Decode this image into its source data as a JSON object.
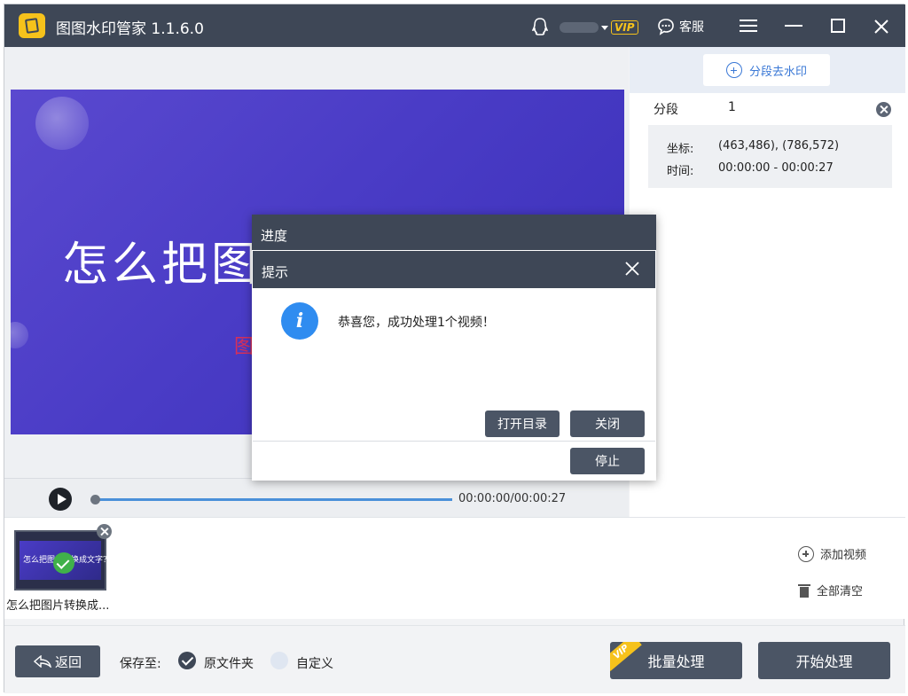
{
  "app": {
    "title": "图图水印管家",
    "version": "1.1.6.0"
  },
  "titlebar": {
    "vip_badge": "VIP",
    "service_label": "客服",
    "icons": [
      "qq-icon",
      "chat-icon",
      "menu-icon",
      "minimize-icon",
      "maximize-icon",
      "close-icon"
    ]
  },
  "preview": {
    "headline": "怎么把图",
    "watermark_fragment": "图",
    "time_readout": "00:00:00/00:00:27"
  },
  "right_panel": {
    "segment_button_label": "分段去水印",
    "segment_label": "分段",
    "segment_number": "1",
    "coord_label": "坐标:",
    "coord_value": "(463,486), (786,572)",
    "time_label": "时间:",
    "time_value": "00:00:00 - 00:00:27"
  },
  "thumbnails": [
    {
      "label": "怎么把图片转换成...",
      "preview_text": "怎么把图片转换成文字?",
      "status": "done"
    }
  ],
  "side_actions": {
    "add_video": "添加视频",
    "clear_all": "全部清空"
  },
  "bottom_bar": {
    "back_label": "返回",
    "save_to_label": "保存至:",
    "options": [
      {
        "label": "原文件夹",
        "selected": true
      },
      {
        "label": "自定义",
        "selected": false
      }
    ],
    "batch_label": "批量处理",
    "batch_vip": "VIP",
    "start_label": "开始处理"
  },
  "progress_dialog": {
    "title": "进度",
    "stop_label": "停止"
  },
  "tip_dialog": {
    "title": "提示",
    "icon_glyph": "i",
    "message": "恭喜您，成功处理1个视频！",
    "open_dir_label": "打开目录",
    "close_label": "关闭"
  },
  "colors": {
    "titlebar": "#3e4756",
    "button": "#4b5565",
    "accent_blue": "#2f8cf0",
    "vip_gold": "#f6c21b",
    "success_green": "#40b14a"
  }
}
